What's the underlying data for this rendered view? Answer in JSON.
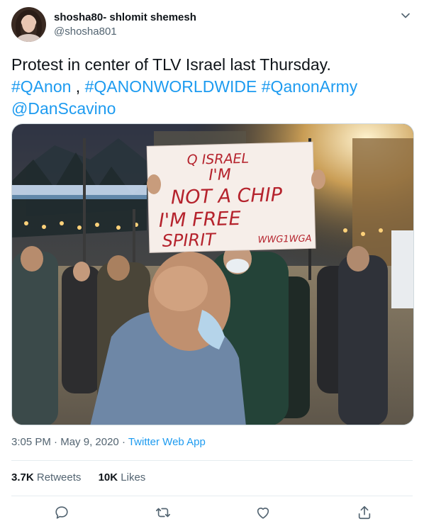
{
  "tweet": {
    "author": {
      "display_name": "shosha80- shlomit shemesh",
      "handle": "@shosha801"
    },
    "text": {
      "line1": "Protest in center of TLV Israel last Thursday.",
      "hashtags": [
        "#QAnon",
        "#QANONWORLDWIDE",
        "#QanonArmy"
      ],
      "separator": " ,",
      "mention": "@DanScavino"
    },
    "sign": {
      "line1": "Q ISRAEL",
      "line2": "I'M",
      "line3": "NOT A CHIP",
      "line4": "I'M FREE",
      "line5": "SPIRIT",
      "tag": "WWG1WGA"
    },
    "meta": {
      "time": "3:05 PM",
      "dot": " · ",
      "date": "May 9, 2020",
      "dot2": " · ",
      "app": "Twitter Web App"
    },
    "stats": {
      "retweets_count": "3.7K",
      "retweets_label": "Retweets",
      "likes_count": "10K",
      "likes_label": "Likes"
    },
    "icons": {
      "caret": "chevron-down-icon",
      "reply": "reply-icon",
      "retweet": "retweet-icon",
      "like": "heart-icon",
      "share": "share-icon"
    },
    "colors": {
      "link": "#1d9bf0",
      "secondary_text": "#536471",
      "primary_text": "#0f1419"
    }
  }
}
